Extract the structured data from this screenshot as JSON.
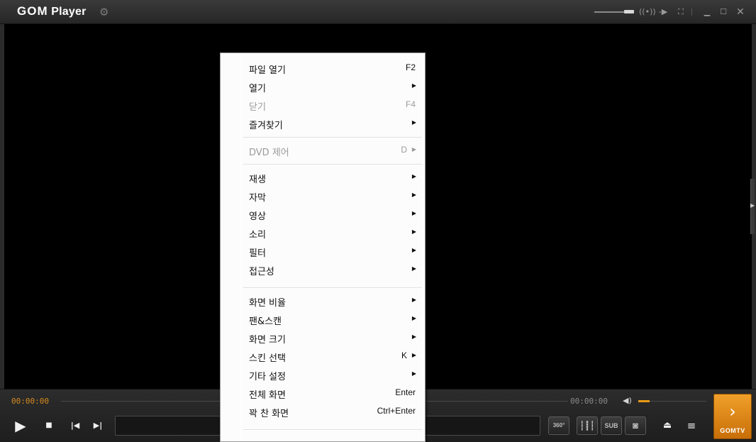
{
  "titlebar": {
    "app_name_bold": "GOM",
    "app_name_rest": " Player",
    "icons": [
      "gear-icon",
      "broadcast-icon",
      "play-next-icon",
      "fullscreen-icon",
      "minimize-icon",
      "maximize-icon",
      "close-icon"
    ]
  },
  "controls": {
    "time_current": "00:00:00",
    "time_total": "00:00:00",
    "buttons": {
      "vr360": "360°",
      "subtitle": "SUB",
      "gomtv": "GOMTV"
    },
    "accent_color": "#e69a16"
  },
  "context_menu": {
    "items": [
      {
        "label": "파일 열기",
        "shortcut": "F2",
        "submenu": false,
        "disabled": false
      },
      {
        "label": "열기",
        "shortcut": "",
        "submenu": true,
        "disabled": false
      },
      {
        "label": "닫기",
        "shortcut": "F4",
        "submenu": false,
        "disabled": true
      },
      {
        "label": "즐겨찾기",
        "shortcut": "",
        "submenu": true,
        "disabled": false
      },
      {
        "label": "DVD 제어",
        "shortcut": "D",
        "submenu": true,
        "disabled": true
      },
      {
        "label": "재생",
        "shortcut": "",
        "submenu": true,
        "disabled": false
      },
      {
        "label": "자막",
        "shortcut": "",
        "submenu": true,
        "disabled": false
      },
      {
        "label": "영상",
        "shortcut": "",
        "submenu": true,
        "disabled": false
      },
      {
        "label": "소리",
        "shortcut": "",
        "submenu": true,
        "disabled": false
      },
      {
        "label": "필터",
        "shortcut": "",
        "submenu": true,
        "disabled": false
      },
      {
        "label": "접근성",
        "shortcut": "",
        "submenu": true,
        "disabled": false
      },
      {
        "label": "화면 비율",
        "shortcut": "",
        "submenu": true,
        "disabled": false
      },
      {
        "label": "팬&스캔",
        "shortcut": "",
        "submenu": true,
        "disabled": false
      },
      {
        "label": "화면 크기",
        "shortcut": "",
        "submenu": true,
        "disabled": false
      },
      {
        "label": "스킨 선택",
        "shortcut": "K",
        "submenu": true,
        "disabled": false
      },
      {
        "label": "기타 설정",
        "shortcut": "",
        "submenu": true,
        "disabled": false
      },
      {
        "label": "전체 화면",
        "shortcut": "Enter",
        "submenu": false,
        "disabled": false
      },
      {
        "label": "꽉 찬 화면",
        "shortcut": "Ctrl+Enter",
        "submenu": false,
        "disabled": false
      }
    ]
  }
}
